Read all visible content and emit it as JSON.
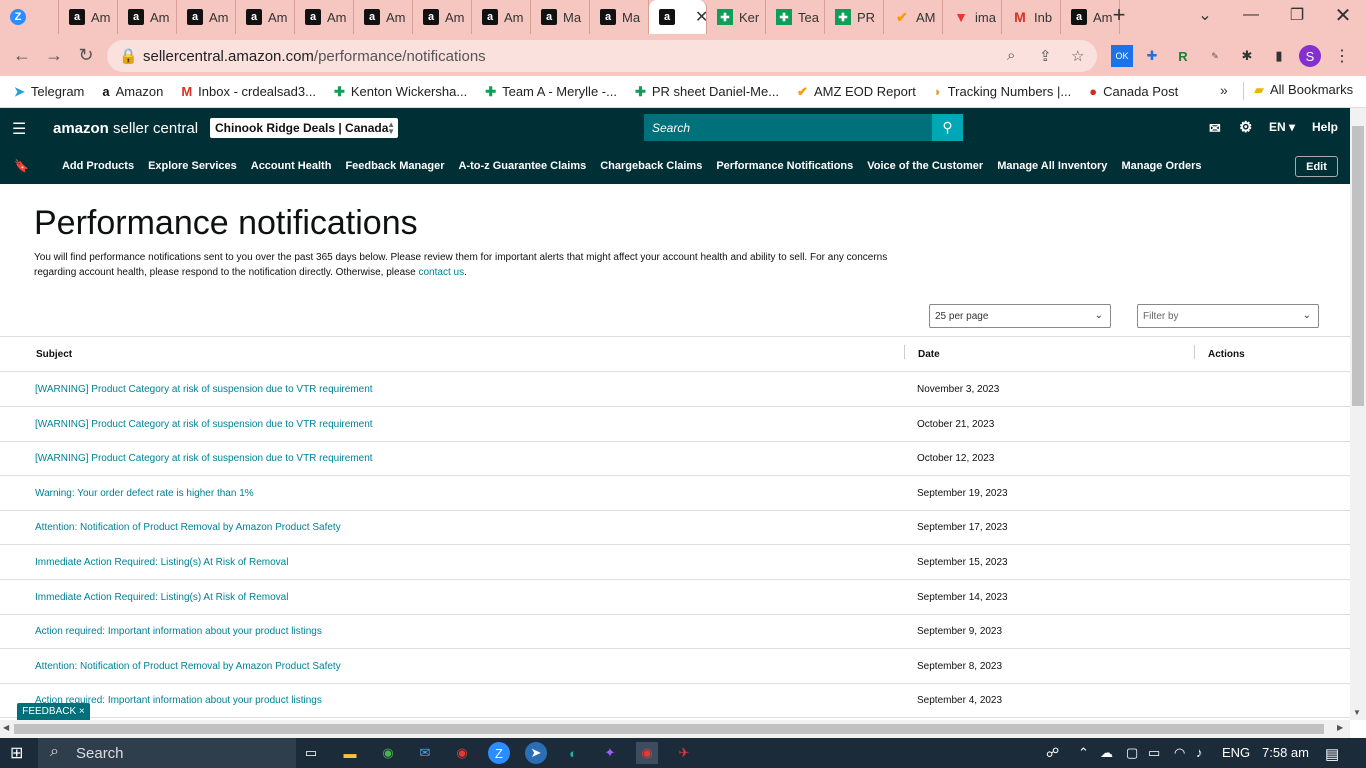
{
  "browser": {
    "tabs": [
      {
        "label": "",
        "icon": "z"
      },
      {
        "label": "Am",
        "icon": "amazon"
      },
      {
        "label": "Am",
        "icon": "amazon"
      },
      {
        "label": "Am",
        "icon": "amazon"
      },
      {
        "label": "Am",
        "icon": "amazon"
      },
      {
        "label": "Am",
        "icon": "amazon"
      },
      {
        "label": "Am",
        "icon": "amazon"
      },
      {
        "label": "Am",
        "icon": "amazon"
      },
      {
        "label": "Am",
        "icon": "amazon"
      },
      {
        "label": "Ma",
        "icon": "amazon"
      },
      {
        "label": "Ma",
        "icon": "amazon"
      },
      {
        "label": "",
        "icon": "amazon",
        "active": true
      },
      {
        "label": "Ker",
        "icon": "sheet"
      },
      {
        "label": "Tea",
        "icon": "sheet"
      },
      {
        "label": "PR",
        "icon": "sheet"
      },
      {
        "label": "AM",
        "icon": "amz"
      },
      {
        "label": "ima",
        "icon": "tri"
      },
      {
        "label": "Inb",
        "icon": "gmail"
      },
      {
        "label": "Am",
        "icon": "amazon"
      }
    ],
    "url_host": "sellercentral.amazon.com",
    "url_path": "/performance/notifications",
    "bookmarks": [
      {
        "label": "Telegram",
        "icon": "telegram-icon"
      },
      {
        "label": "Amazon",
        "icon": "amazon-icon"
      },
      {
        "label": "Inbox - crdealsad3...",
        "icon": "gmail-icon"
      },
      {
        "label": "Kenton Wickersha...",
        "icon": "sheet-icon"
      },
      {
        "label": "Team A - Merylle -...",
        "icon": "sheet-icon"
      },
      {
        "label": "PR sheet Daniel-Me...",
        "icon": "sheet-icon"
      },
      {
        "label": "AMZ EOD Report",
        "icon": "amz-icon"
      },
      {
        "label": "Tracking Numbers |...",
        "icon": "taco-icon"
      },
      {
        "label": "Canada Post",
        "icon": "canadapost-icon"
      }
    ],
    "all_bookmarks": "All Bookmarks",
    "profile_initial": "S"
  },
  "header": {
    "logo_bold": "amazon",
    "logo_rest": " seller central",
    "store": "Chinook Ridge Deals | Canada",
    "search_placeholder": "Search",
    "lang": "EN",
    "help": "Help"
  },
  "nav": {
    "items": [
      "Add Products",
      "Explore Services",
      "Account Health",
      "Feedback Manager",
      "A-to-z Guarantee Claims",
      "Chargeback Claims",
      "Performance Notifications",
      "Voice of the Customer",
      "Manage All Inventory",
      "Manage Orders"
    ],
    "edit": "Edit"
  },
  "page": {
    "title": "Performance notifications",
    "description": "You will find performance notifications sent to you over the past 365 days below. Please review them for important alerts that might affect your account health and ability to sell. For any concerns regarding account health, please respond to the notification directly. Otherwise, please ",
    "contact_link": "contact us",
    "period": ".",
    "per_page": "25 per page",
    "filter": "Filter by"
  },
  "table": {
    "headers": {
      "subject": "Subject",
      "date": "Date",
      "actions": "Actions"
    },
    "rows": [
      {
        "subject": "[WARNING] Product Category at risk of suspension due to VTR requirement",
        "date": "November 3, 2023"
      },
      {
        "subject": "[WARNING] Product Category at risk of suspension due to VTR requirement",
        "date": "October 21, 2023"
      },
      {
        "subject": "[WARNING] Product Category at risk of suspension due to VTR requirement",
        "date": "October 12, 2023"
      },
      {
        "subject": "Warning: Your order defect rate is higher than 1%",
        "date": "September 19, 2023"
      },
      {
        "subject": "Attention: Notification of Product Removal by Amazon Product Safety",
        "date": "September 17, 2023"
      },
      {
        "subject": "Immediate Action Required: Listing(s) At Risk of Removal",
        "date": "September 15, 2023"
      },
      {
        "subject": "Immediate Action Required: Listing(s) At Risk of Removal",
        "date": "September 14, 2023"
      },
      {
        "subject": "Action required: Important information about your product listings",
        "date": "September 9, 2023"
      },
      {
        "subject": "Attention: Notification of Product Removal by Amazon Product Safety",
        "date": "September 8, 2023"
      },
      {
        "subject": "Action required: Important information about your product listings",
        "date": "September 4, 2023"
      }
    ]
  },
  "feedback": "FEEDBACK ×",
  "taskbar": {
    "search": "Search",
    "lang": "ENG",
    "time": "7:58 am"
  },
  "colors": {
    "brand_dark": "#002f36",
    "link": "#008296",
    "tab_bg": "#f5c7c0"
  }
}
